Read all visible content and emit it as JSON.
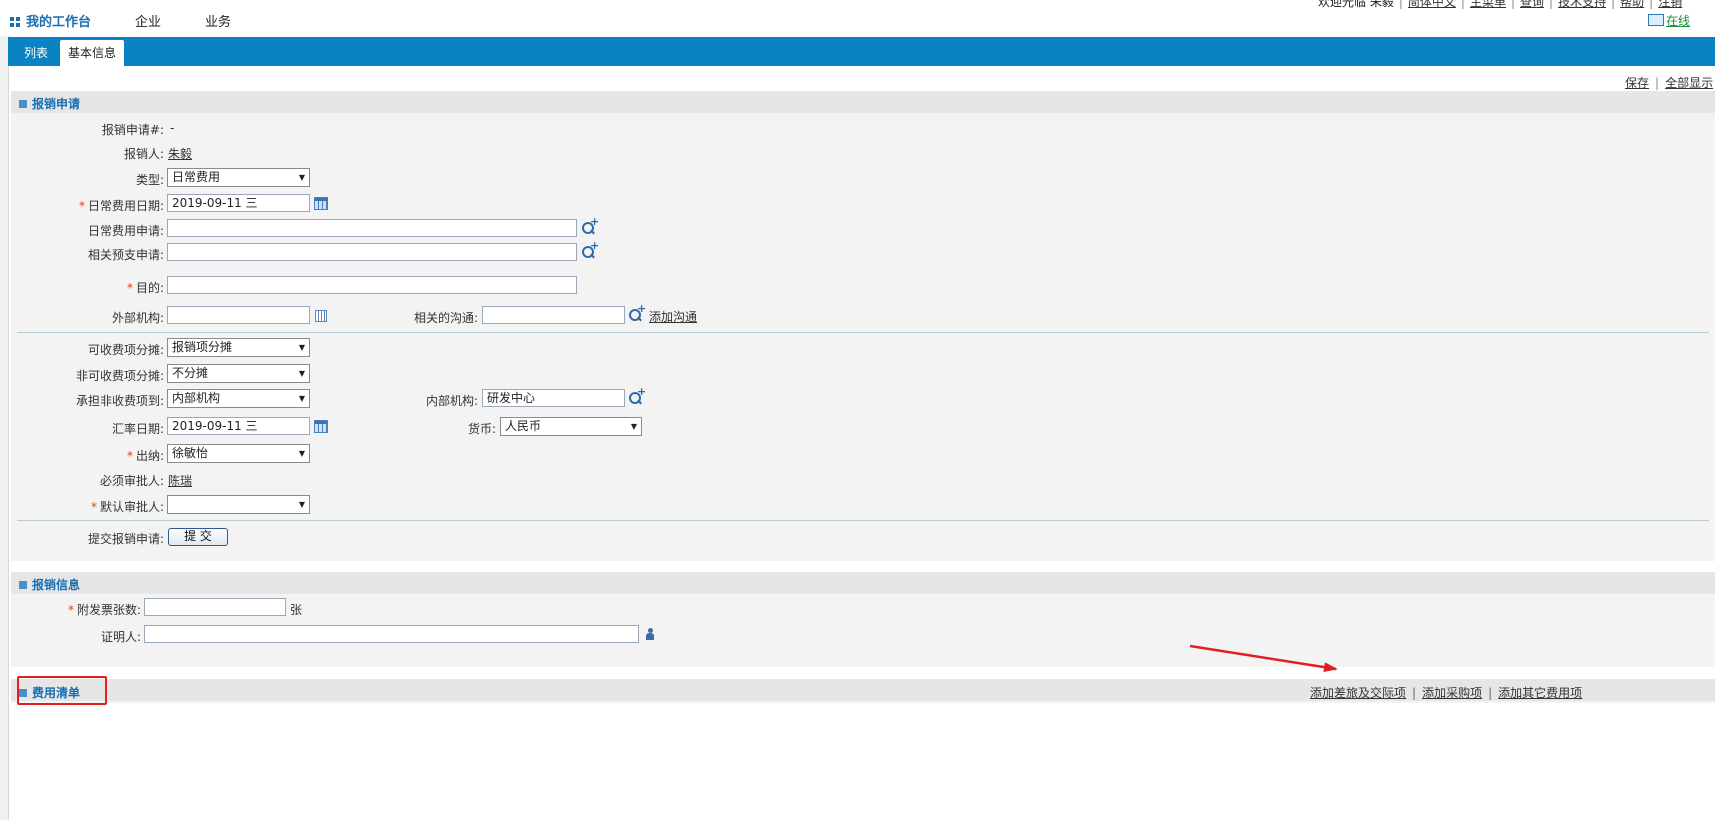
{
  "nav": {
    "brand": "我的工作台",
    "menu": [
      "企业",
      "业务"
    ],
    "top_links": [
      "欢迎光临 朱毅",
      "简体中文",
      "主菜单",
      "查询",
      "技术支持",
      "帮助",
      "注销"
    ],
    "online": "在线"
  },
  "tabs": [
    "列表",
    "基本信息"
  ],
  "actions": {
    "save": "保存",
    "show_all": "全部显示"
  },
  "sections": {
    "request": "报销申请",
    "info": "报销信息",
    "expenses": "费用清单"
  },
  "form": {
    "request_no": {
      "label": "报销申请#:",
      "value": "-"
    },
    "applicant": {
      "label": "报销人:",
      "value": "朱毅"
    },
    "type": {
      "label": "类型:",
      "value": "日常费用"
    },
    "daily_date": {
      "label": "日常费用日期:",
      "value": "2019-09-11 三"
    },
    "daily_request": {
      "label": "日常费用申请:",
      "value": ""
    },
    "advance_request": {
      "label": "相关预支申请:",
      "value": ""
    },
    "purpose": {
      "label": "目的:",
      "value": ""
    },
    "external_org": {
      "label": "外部机构:",
      "value": ""
    },
    "related_comm": {
      "label": "相关的沟通:",
      "value": "",
      "add_link": "添加沟通"
    },
    "chargeable": {
      "label": "可收费项分摊:",
      "value": "报销项分摊"
    },
    "nonchargeable": {
      "label": "非可收费项分摊:",
      "value": "不分摊"
    },
    "bear_to": {
      "label": "承担非收费项到:",
      "value": "内部机构"
    },
    "internal_org": {
      "label": "内部机构:",
      "value": "研发中心"
    },
    "rate_date": {
      "label": "汇率日期:",
      "value": "2019-09-11 三"
    },
    "currency": {
      "label": "货币:",
      "value": "人民币"
    },
    "cashier": {
      "label": "出纳:",
      "value": "徐敏怡"
    },
    "required_approver": {
      "label": "必须审批人:",
      "value": "陈瑞"
    },
    "default_approver": {
      "label": "默认审批人:",
      "value": ""
    },
    "submit": {
      "label": "提交报销申请:",
      "button": "提 交"
    }
  },
  "info": {
    "invoices": {
      "label": "附发票张数:",
      "value": "",
      "unit": "张"
    },
    "witness": {
      "label": "证明人:",
      "value": ""
    }
  },
  "expense_links": [
    "添加差旅及交际项",
    "添加采购项",
    "添加其它费用项"
  ],
  "colors": {
    "accent": "#0a83c2",
    "annotation": "#e02020"
  }
}
